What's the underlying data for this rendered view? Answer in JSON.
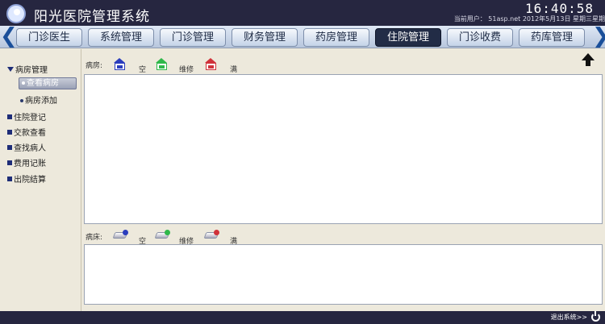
{
  "header": {
    "title": "阳光医院管理系统",
    "clock": "16:40:58",
    "user_line": "当前用户： 51asp.net  2012年5月13日 星期三星期"
  },
  "nav": {
    "tabs": [
      "门诊医生",
      "系统管理",
      "门诊管理",
      "财务管理",
      "药房管理",
      "住院管理",
      "门诊收费",
      "药库管理"
    ],
    "active_index": 5,
    "left_arrow": "❮",
    "right_arrow": "❯"
  },
  "sidebar": {
    "group_title": "病房管理",
    "sub_items": [
      "查看病房",
      "病房添加"
    ],
    "active_sub": 0,
    "items": [
      "住院登记",
      "交款查看",
      "查找病人",
      "费用记账",
      "出院结算"
    ]
  },
  "rooms": {
    "label": "病房:",
    "legend": [
      {
        "text": "空",
        "color": "#2b3dbd"
      },
      {
        "text": "维修",
        "color": "#2fb84a"
      },
      {
        "text": "满",
        "color": "#d0323a"
      }
    ]
  },
  "beds": {
    "label": "病床:",
    "legend": [
      {
        "text": "空",
        "color": "#2b3dbd"
      },
      {
        "text": "维修",
        "color": "#2fb84a"
      },
      {
        "text": "满",
        "color": "#d0323a"
      }
    ]
  },
  "footer": {
    "logout": "退出系统>>"
  },
  "icons": {
    "logo": "hospital-logo-icon",
    "top": "arrow-up-icon",
    "power": "power-icon"
  }
}
